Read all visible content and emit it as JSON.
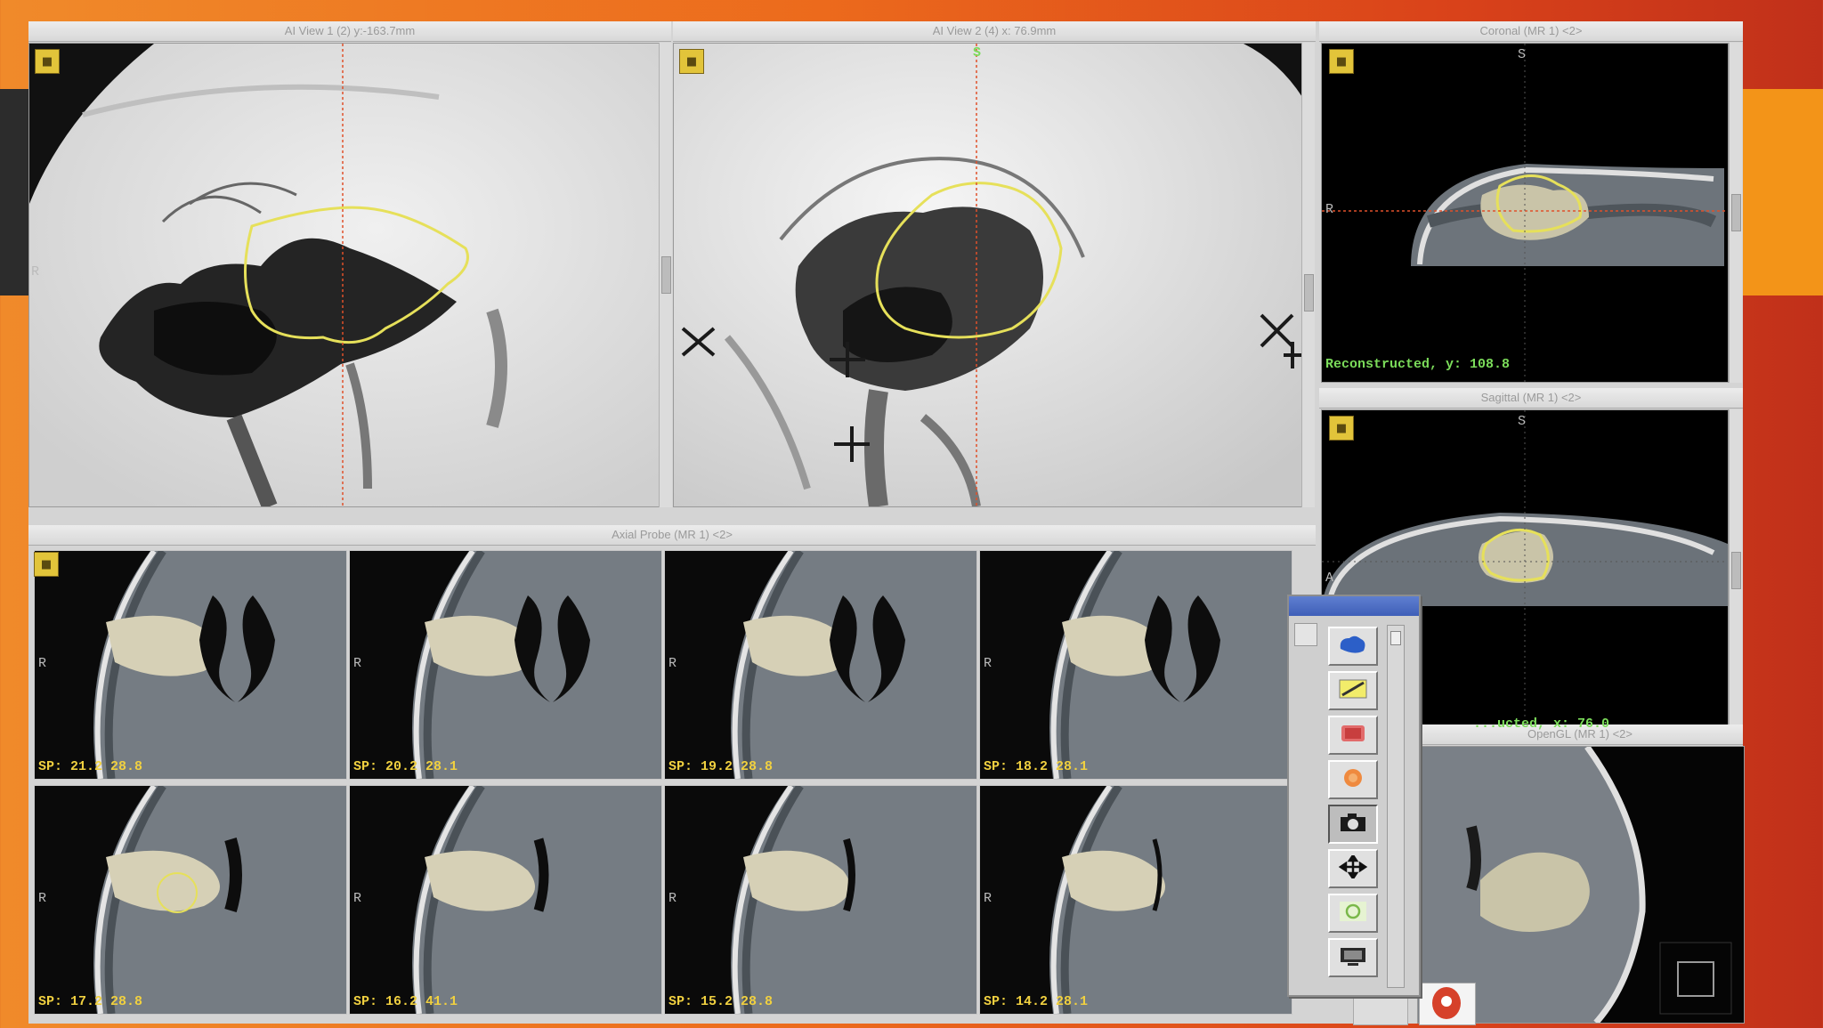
{
  "views": {
    "ai1": {
      "title": "AI View 1 (2) y:-163.7mm",
      "orient": "R"
    },
    "ai2": {
      "title": "AI View 2 (4) x: 76.9mm",
      "orient": "S"
    },
    "coronal": {
      "title": "Coronal (MR 1) <2>",
      "top": "S",
      "left": "R",
      "status": "Reconstructed, y: 108.8"
    },
    "sagittal": {
      "title": "Sagittal (MR 1) <2>",
      "top": "S",
      "left": "A",
      "status": "...ucted, x: 76.0"
    },
    "axial": {
      "title": "Axial Probe (MR 1) <2>"
    },
    "opengl": {
      "title": "OpenGL (MR 1) <2>"
    }
  },
  "axial_cells": [
    {
      "label": "SP: 21.2 28.8",
      "side": "R"
    },
    {
      "label": "SP: 20.2 28.1",
      "side": "R"
    },
    {
      "label": "SP: 19.2 28.8",
      "side": "R"
    },
    {
      "label": "SP: 18.2 28.1",
      "side": "R"
    },
    {
      "label": "SP: 17.2 28.8",
      "side": "R"
    },
    {
      "label": "SP: 16.2 41.1",
      "side": "R"
    },
    {
      "label": "SP: 15.2 28.8",
      "side": "R"
    },
    {
      "label": "SP: 14.2 28.1",
      "side": "R"
    }
  ],
  "toolbox": {
    "tools": [
      "region-blob-icon",
      "pencil-draw-icon",
      "volume-red-icon",
      "sphere-orange-icon",
      "camera-icon",
      "move-arrows-icon",
      "ring-green-icon",
      "monitor-icon"
    ],
    "active_tool": "camera-icon"
  },
  "colors": {
    "contour": "#e6e05a",
    "crosshair": "#e0502a",
    "status_text": "#7bdc5a",
    "label_text": "#f0d040"
  }
}
